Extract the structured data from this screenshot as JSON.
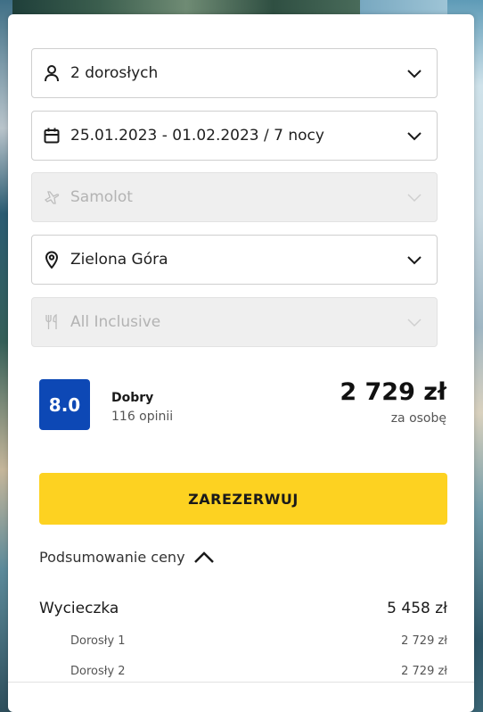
{
  "colors": {
    "rating_bg": "#0d48b5",
    "book_button_bg": "#fdd221",
    "disabled_field_bg": "#efefef"
  },
  "fields": [
    {
      "icon": "person-icon",
      "value": "2 dorosłych",
      "disabled": false
    },
    {
      "icon": "calendar-icon",
      "value": "25.01.2023 - 01.02.2023 / 7 nocy",
      "disabled": false
    },
    {
      "icon": "plane-icon",
      "value": "Samolot",
      "disabled": true
    },
    {
      "icon": "location-pin-icon",
      "value": "Zielona Góra",
      "disabled": false
    },
    {
      "icon": "cutlery-icon",
      "value": "All Inclusive",
      "disabled": true
    }
  ],
  "rating": {
    "score": "8.0",
    "label": "Dobry",
    "reviews": "116 opinii"
  },
  "price": {
    "amount": "2 729 zł",
    "note": "za osobę"
  },
  "book_button": "ZAREZERWUJ",
  "summary": {
    "toggle_label": "Podsumowanie ceny",
    "trip_label": "Wycieczka",
    "trip_total": "5 458 zł",
    "lines": [
      {
        "label": "Dorosły 1",
        "amount": "2 729 zł"
      },
      {
        "label": "Dorosły 2",
        "amount": "2 729 zł"
      }
    ]
  }
}
